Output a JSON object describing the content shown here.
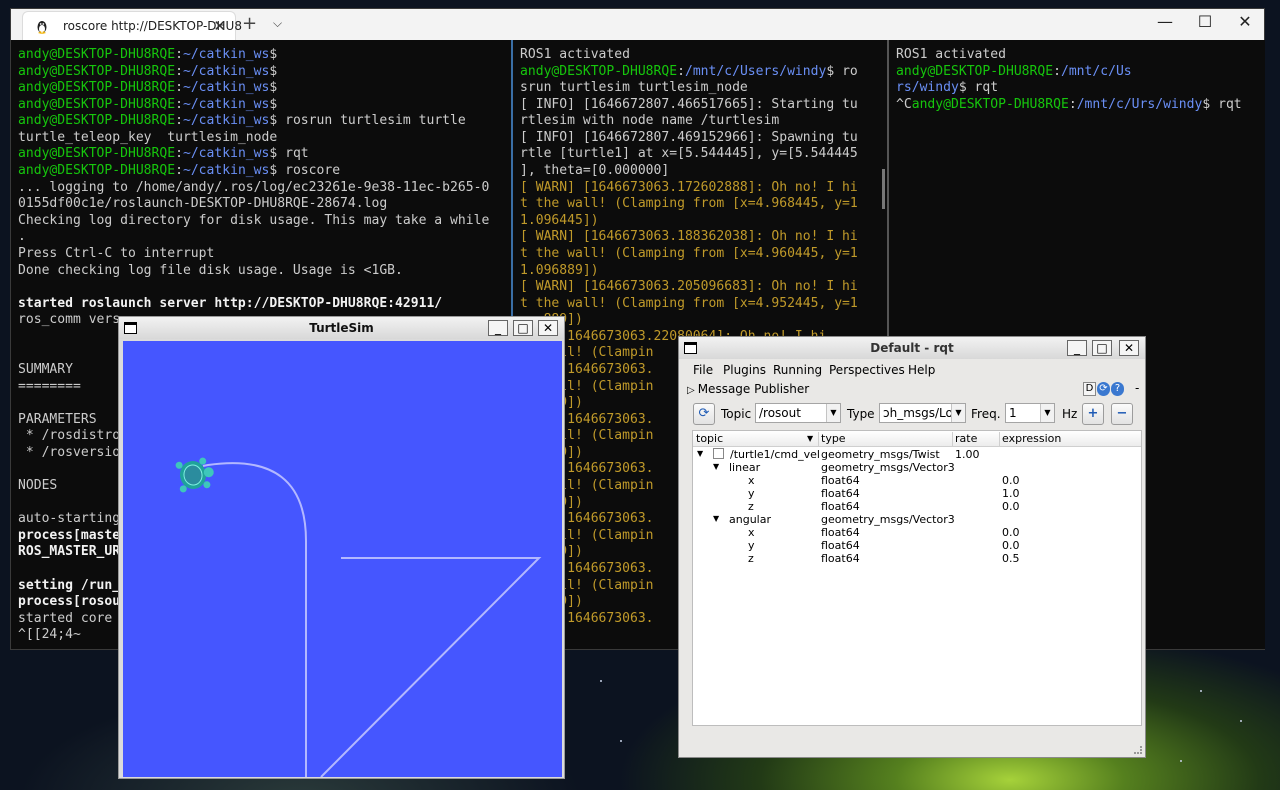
{
  "terminal": {
    "tab_title": "roscore http://DESKTOP-DHU8",
    "close_glyph": "✕",
    "new_tab_glyph": "+",
    "dropdown_glyph": "⌵",
    "minimize_glyph": "—",
    "maximize_glyph": "☐",
    "window_close_glyph": "✕",
    "pane1_lines": [
      [
        {
          "t": "andy@DESKTOP-DHU8RQE",
          "c": "ug"
        },
        {
          "t": ":"
        },
        {
          "t": "~/catkin_ws",
          "c": "pb"
        },
        {
          "t": "$"
        }
      ],
      [
        {
          "t": "andy@DESKTOP-DHU8RQE",
          "c": "ug"
        },
        {
          "t": ":"
        },
        {
          "t": "~/catkin_ws",
          "c": "pb"
        },
        {
          "t": "$"
        }
      ],
      [
        {
          "t": "andy@DESKTOP-DHU8RQE",
          "c": "ug"
        },
        {
          "t": ":"
        },
        {
          "t": "~/catkin_ws",
          "c": "pb"
        },
        {
          "t": "$"
        }
      ],
      [
        {
          "t": "andy@DESKTOP-DHU8RQE",
          "c": "ug"
        },
        {
          "t": ":"
        },
        {
          "t": "~/catkin_ws",
          "c": "pb"
        },
        {
          "t": "$"
        }
      ],
      [
        {
          "t": "andy@DESKTOP-DHU8RQE",
          "c": "ug"
        },
        {
          "t": ":"
        },
        {
          "t": "~/catkin_ws",
          "c": "pb"
        },
        {
          "t": "$ rosrun turtlesim turtle"
        }
      ],
      [
        {
          "t": "turtle_teleop_key  turtlesim_node"
        }
      ],
      [
        {
          "t": "andy@DESKTOP-DHU8RQE",
          "c": "ug"
        },
        {
          "t": ":"
        },
        {
          "t": "~/catkin_ws",
          "c": "pb"
        },
        {
          "t": "$ rqt"
        }
      ],
      [
        {
          "t": "andy@DESKTOP-DHU8RQE",
          "c": "ug"
        },
        {
          "t": ":"
        },
        {
          "t": "~/catkin_ws",
          "c": "pb"
        },
        {
          "t": "$ roscore"
        }
      ],
      [
        {
          "t": "... logging to /home/andy/.ros/log/ec23261e-9e38-11ec-b265-0"
        }
      ],
      [
        {
          "t": "0155df00c1e/roslaunch-DESKTOP-DHU8RQE-28674.log"
        }
      ],
      [
        {
          "t": "Checking log directory for disk usage. This may take a while"
        }
      ],
      [
        {
          "t": "."
        }
      ],
      [
        {
          "t": "Press Ctrl-C to interrupt"
        }
      ],
      [
        {
          "t": "Done checking log file disk usage. Usage is <1GB."
        }
      ],
      [
        {
          "t": ""
        }
      ],
      [
        {
          "t": "started roslaunch server http://DESKTOP-DHU8RQE:42911/",
          "c": "bw"
        }
      ],
      [
        {
          "t": "ros_comm vers"
        }
      ],
      [
        {
          "t": ""
        }
      ],
      [
        {
          "t": ""
        }
      ],
      [
        {
          "t": "SUMMARY"
        }
      ],
      [
        {
          "t": "========"
        }
      ],
      [
        {
          "t": ""
        }
      ],
      [
        {
          "t": "PARAMETERS"
        }
      ],
      [
        {
          "t": " * /rosdistro"
        }
      ],
      [
        {
          "t": " * /rosversio"
        }
      ],
      [
        {
          "t": ""
        }
      ],
      [
        {
          "t": "NODES"
        }
      ],
      [
        {
          "t": ""
        }
      ],
      [
        {
          "t": "auto-starting"
        }
      ],
      [
        {
          "t": "process[maste",
          "c": "bw"
        }
      ],
      [
        {
          "t": "ROS_MASTER_UR",
          "c": "bw"
        }
      ],
      [
        {
          "t": ""
        }
      ],
      [
        {
          "t": "setting /run_",
          "c": "bw"
        }
      ],
      [
        {
          "t": "process[rosou",
          "c": "bw"
        }
      ],
      [
        {
          "t": "started core"
        }
      ],
      [
        {
          "t": "^[[24;4~"
        }
      ]
    ],
    "pane2_lines": [
      [
        {
          "t": "ROS1 activated"
        }
      ],
      [
        {
          "t": "andy@DESKTOP-DHU8RQE",
          "c": "ug"
        },
        {
          "t": ":"
        },
        {
          "t": "/mnt/c/Users/windy",
          "c": "pb"
        },
        {
          "t": "$ ro"
        }
      ],
      [
        {
          "t": "srun turtlesim turtlesim_node"
        }
      ],
      [
        {
          "t": "[ INFO] [1646672807.466517665]: Starting tu"
        }
      ],
      [
        {
          "t": "rtlesim with node name /turtlesim"
        }
      ],
      [
        {
          "t": "[ INFO] [1646672807.469152966]: Spawning tu"
        }
      ],
      [
        {
          "t": "rtle [turtle1] at x=[5.544445], y=[5.544445"
        }
      ],
      [
        {
          "t": "], theta=[0.000000]"
        }
      ],
      [
        {
          "t": "[ WARN] [1646673063.172602888]: Oh no! I hi",
          "c": "w"
        }
      ],
      [
        {
          "t": "t the wall! (Clamping from [x=4.968445, y=1",
          "c": "w"
        }
      ],
      [
        {
          "t": "1.096445])",
          "c": "w"
        }
      ],
      [
        {
          "t": "[ WARN] [1646673063.188362038]: Oh no! I hi",
          "c": "w"
        }
      ],
      [
        {
          "t": "t the wall! (Clamping from [x=4.960445, y=1",
          "c": "w"
        }
      ],
      [
        {
          "t": "1.096889])",
          "c": "w"
        }
      ],
      [
        {
          "t": "[ WARN] [1646673063.205096683]: Oh no! I hi",
          "c": "w"
        }
      ],
      [
        {
          "t": "t the wall! (Clamping from [x=4.952445, y=1",
          "c": "w"
        }
      ],
      [
        {
          "t": "   889])",
          "c": "w"
        }
      ],
      [
        {
          "t": "   ] [1646673063.22080064]: Oh no! I hi",
          "c": "w"
        }
      ],
      [
        {
          "t": "   wall! (Clampin",
          "c": "w"
        }
      ],
      [
        {
          "t": "   ] [1646673063.",
          "c": "w"
        }
      ],
      [
        {
          "t": "   wall! (Clampin",
          "c": "w"
        }
      ],
      [
        {
          "t": "   889])",
          "c": "w"
        }
      ],
      [
        {
          "t": "   ] [1646673063.",
          "c": "w"
        }
      ],
      [
        {
          "t": "   wall! (Clampin",
          "c": "w"
        }
      ],
      [
        {
          "t": "   889])",
          "c": "w"
        }
      ],
      [
        {
          "t": "   ] [1646673063.",
          "c": "w"
        }
      ],
      [
        {
          "t": "   wall! (Clampin",
          "c": "w"
        }
      ],
      [
        {
          "t": "   889])",
          "c": "w"
        }
      ],
      [
        {
          "t": "   ] [1646673063.",
          "c": "w"
        }
      ],
      [
        {
          "t": "   wall! (Clampin",
          "c": "w"
        }
      ],
      [
        {
          "t": "   889])",
          "c": "w"
        }
      ],
      [
        {
          "t": "   ] [1646673063.",
          "c": "w"
        }
      ],
      [
        {
          "t": "   wall! (Clampin",
          "c": "w"
        }
      ],
      [
        {
          "t": "   889])",
          "c": "w"
        }
      ],
      [
        {
          "t": "   ] [1646673063.",
          "c": "w"
        }
      ]
    ],
    "pane3_lines": [
      [
        {
          "t": "ROS1 activated"
        }
      ],
      [
        {
          "t": "andy@DESKTOP-DHU8RQE",
          "c": "ug"
        },
        {
          "t": ":"
        },
        {
          "t": "/mnt/c/Us",
          "c": "pb"
        }
      ],
      [
        {
          "t": "rs/windy",
          "c": "pb"
        },
        {
          "t": "$ rqt"
        }
      ],
      [
        {
          "t": "^C"
        },
        {
          "t": "andy@DESKTOP-DHU8RQE",
          "c": "ug"
        },
        {
          "t": ":"
        },
        {
          "t": "/mnt/c/Urs/windy",
          "c": "pb"
        },
        {
          "t": "$ rqt"
        }
      ]
    ]
  },
  "turtlesim": {
    "title": "TurtleSim",
    "minimize_glyph": "_",
    "maximize_glyph": "□",
    "close_glyph": "✕",
    "background_color": "#4556ff",
    "pen_color": "#b3b8ff"
  },
  "rqt": {
    "title": "Default - rqt",
    "minimize_glyph": "_",
    "maximize_glyph": "□",
    "close_glyph": "✕",
    "menu": [
      "File",
      "Plugins",
      "Running",
      "Perspectives",
      "Help"
    ],
    "plugin_name": "Message Publisher",
    "plugin_corner": "D",
    "plugin_dash": "-",
    "refresh_glyph": "⟳",
    "topic_label": "Topic",
    "topic_value": "/rosout",
    "type_label": "Type",
    "type_value": "ɔh_msgs/Log",
    "freq_label": "Freq.",
    "freq_value": "1",
    "hz_label": "Hz",
    "add_glyph": "+",
    "remove_glyph": "−",
    "columns": [
      "topic",
      "type",
      "rate",
      "expression"
    ],
    "rows": [
      {
        "indent": 0,
        "arrow": "▼",
        "check": true,
        "name": "/turtle1/cmd_vel",
        "type": "geometry_msgs/Twist",
        "rate": "1.00",
        "expr": ""
      },
      {
        "indent": 1,
        "arrow": "▼",
        "check": false,
        "name": "linear",
        "type": "geometry_msgs/Vector3",
        "rate": "",
        "expr": ""
      },
      {
        "indent": 2,
        "arrow": "",
        "check": false,
        "name": "x",
        "type": "float64",
        "rate": "",
        "expr": "0.0"
      },
      {
        "indent": 2,
        "arrow": "",
        "check": false,
        "name": "y",
        "type": "float64",
        "rate": "",
        "expr": "1.0"
      },
      {
        "indent": 2,
        "arrow": "",
        "check": false,
        "name": "z",
        "type": "float64",
        "rate": "",
        "expr": "0.0"
      },
      {
        "indent": 1,
        "arrow": "▼",
        "check": false,
        "name": "angular",
        "type": "geometry_msgs/Vector3",
        "rate": "",
        "expr": ""
      },
      {
        "indent": 2,
        "arrow": "",
        "check": false,
        "name": "x",
        "type": "float64",
        "rate": "",
        "expr": "0.0"
      },
      {
        "indent": 2,
        "arrow": "",
        "check": false,
        "name": "y",
        "type": "float64",
        "rate": "",
        "expr": "0.0"
      },
      {
        "indent": 2,
        "arrow": "",
        "check": false,
        "name": "z",
        "type": "float64",
        "rate": "",
        "expr": "0.5"
      }
    ]
  }
}
